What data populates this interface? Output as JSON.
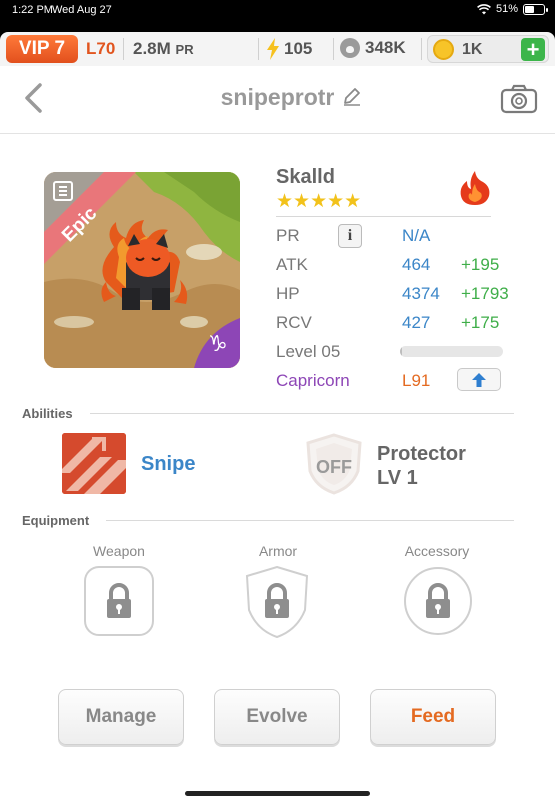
{
  "status_bar": {
    "time": "1:22 PM",
    "date": "Wed Aug 27",
    "battery": "51%",
    "battery_level": 0.51
  },
  "top_bar": {
    "vip": "VIP 7",
    "level": "L70",
    "power": "2.8M",
    "power_unit": "PR",
    "energy": "105",
    "paws": "348K",
    "coins": "1K",
    "add_label": "+"
  },
  "header": {
    "title": "snipeprotr"
  },
  "pet": {
    "rarity": "Epic",
    "name": "Skalld",
    "stars": 5,
    "star_glyphs": "★★★★★",
    "element": "fire",
    "zodiac_badge": "♑"
  },
  "stats": [
    {
      "label": "PR",
      "value": "N/A",
      "bonus": ""
    },
    {
      "label": "ATK",
      "value": "464",
      "bonus": "+195"
    },
    {
      "label": "HP",
      "value": "4374",
      "bonus": "+1793"
    },
    {
      "label": "RCV",
      "value": "427",
      "bonus": "+175"
    }
  ],
  "info_label": "i",
  "level_row": {
    "label": "Level 05",
    "progress": 0.02
  },
  "zodiac_row": {
    "label": "Capricorn",
    "level": "L91"
  },
  "abilities": {
    "heading": "Abilities",
    "active": {
      "name": "Snipe"
    },
    "passive": {
      "badge": "OFF",
      "name": "Protector",
      "level": "LV 1"
    }
  },
  "equipment": {
    "heading": "Equipment",
    "slots": [
      {
        "label": "Weapon",
        "shape": "rounded-square"
      },
      {
        "label": "Armor",
        "shape": "shield"
      },
      {
        "label": "Accessory",
        "shape": "circle"
      }
    ]
  },
  "actions": {
    "manage": "Manage",
    "evolve": "Evolve",
    "feed": "Feed"
  },
  "colors": {
    "accent_orange": "#e46a21",
    "value_blue": "#3b86c8",
    "bonus_green": "#3fae49",
    "zodiac_purple": "#8d46b6",
    "star_gold": "#f2c21b"
  }
}
